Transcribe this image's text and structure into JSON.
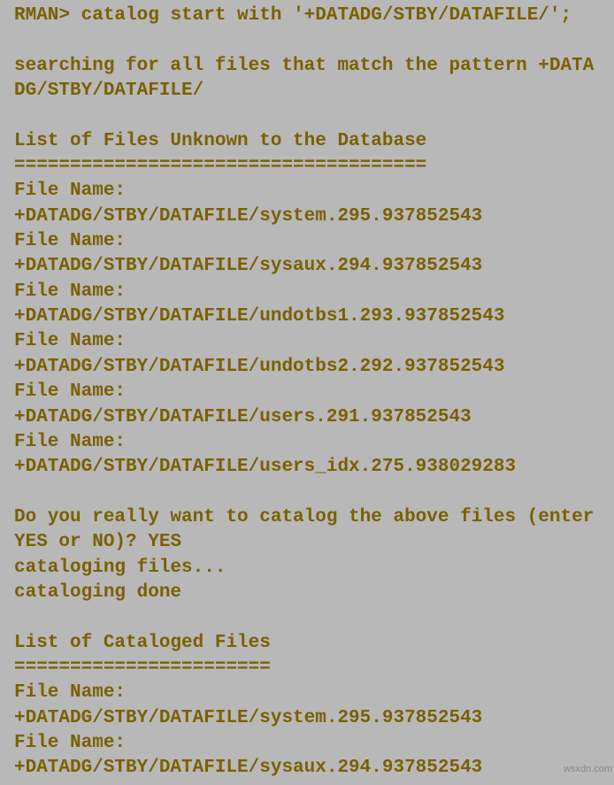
{
  "terminal": {
    "prompt": "RMAN>",
    "command": "catalog start with '+DATADG/STBY/DATAFILE/';",
    "searching_line": "searching for all files that match the pattern +DATADG/STBY/DATAFILE/",
    "unknown_header": "List of Files Unknown to the Database",
    "unknown_divider": "=====================================",
    "file_label": "File Name:",
    "unknown_files": [
      "+DATADG/STBY/DATAFILE/system.295.937852543",
      "+DATADG/STBY/DATAFILE/sysaux.294.937852543",
      "+DATADG/STBY/DATAFILE/undotbs1.293.937852543",
      "+DATADG/STBY/DATAFILE/undotbs2.292.937852543",
      "+DATADG/STBY/DATAFILE/users.291.937852543",
      "+DATADG/STBY/DATAFILE/users_idx.275.938029283"
    ],
    "confirm_prompt": "Do you really want to catalog the above files (enter YES or NO)?",
    "confirm_answer": "YES",
    "cataloging_progress": "cataloging files...",
    "cataloging_done": "cataloging done",
    "cataloged_header": "List of Cataloged Files",
    "cataloged_divider": "=======================",
    "cataloged_files": [
      "+DATADG/STBY/DATAFILE/system.295.937852543",
      "+DATADG/STBY/DATAFILE/sysaux.294.937852543"
    ]
  },
  "watermark": "wsxdn.com"
}
